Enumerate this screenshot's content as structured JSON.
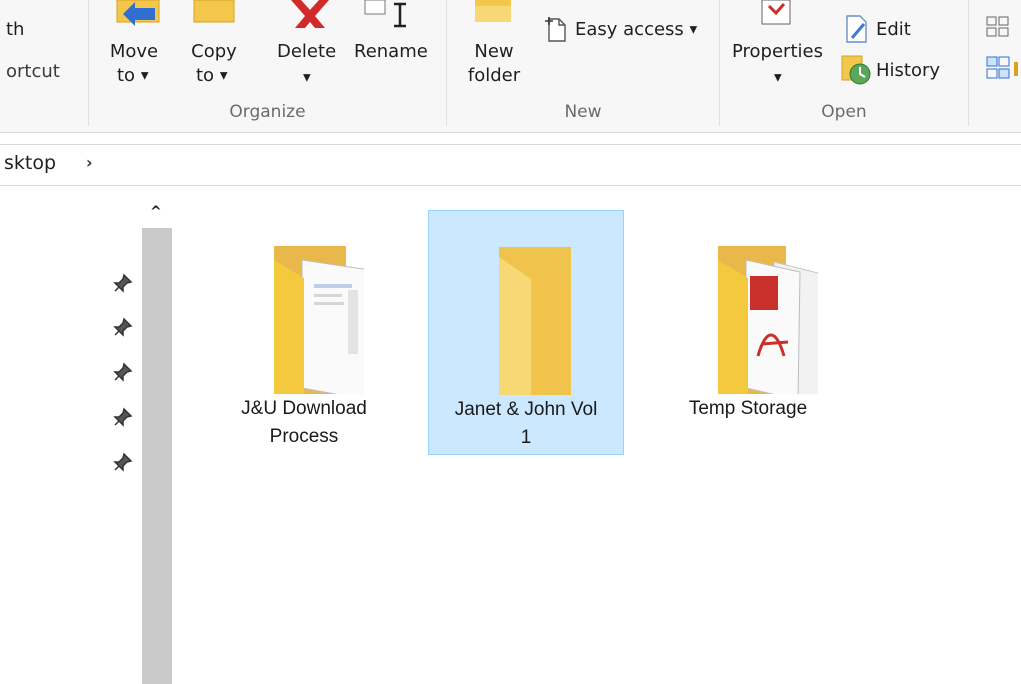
{
  "ribbon": {
    "clipboard_partial": {
      "line1": "th",
      "line2": "ortcut"
    },
    "organize": {
      "group_label": "Organize",
      "move_to": {
        "line1": "Move",
        "line2": "to"
      },
      "copy_to": {
        "line1": "Copy",
        "line2": "to"
      },
      "delete": "Delete",
      "rename": "Rename"
    },
    "new": {
      "group_label": "New",
      "new_folder": {
        "line1": "New",
        "line2": "folder"
      },
      "easy_access": "Easy access"
    },
    "open": {
      "group_label": "Open",
      "properties": "Properties",
      "edit": "Edit",
      "history": "History"
    }
  },
  "address": {
    "path_tail": "sktop"
  },
  "content": {
    "items": [
      {
        "label_line1": "J&U Download",
        "label_line2": "Process"
      },
      {
        "label_line1": "Janet & John Vol",
        "label_line2": "1",
        "selected": true
      },
      {
        "label_line1": "Temp Storage",
        "label_line2": ""
      }
    ]
  },
  "colors": {
    "selection_bg": "#cce8ff",
    "selection_border": "#99d1ff",
    "folder_yellow": "#f8d775",
    "scroll_track": "#c9c9c9"
  },
  "icons": [
    "move-to-icon",
    "copy-to-icon",
    "delete-icon",
    "rename-icon",
    "new-folder-icon",
    "easy-access-icon",
    "properties-icon",
    "edit-icon",
    "history-icon",
    "select-icon",
    "pin-icon",
    "folder-icon"
  ]
}
